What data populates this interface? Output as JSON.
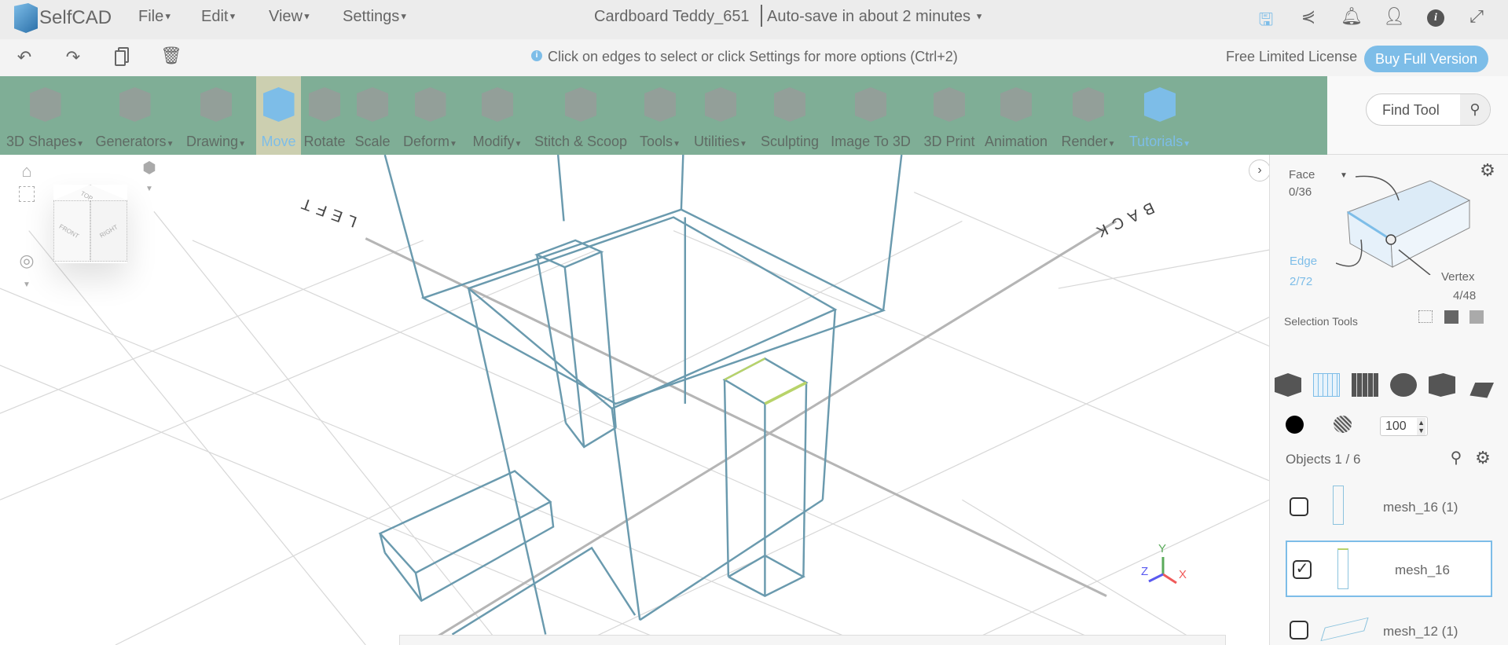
{
  "app": {
    "name": "SelfCAD",
    "document_title": "Cardboard Teddy_651",
    "autosave": "Auto-save in about 2 minutes"
  },
  "menu": [
    {
      "label": "File"
    },
    {
      "label": "Edit"
    },
    {
      "label": "View"
    },
    {
      "label": "Settings"
    }
  ],
  "header_icons": [
    "save-icon",
    "share-icon",
    "bell-icon",
    "user-icon",
    "info-icon",
    "fullscreen-icon"
  ],
  "toolbar": {
    "hint": "Click on edges to select or click Settings for more options (Ctrl+2)",
    "license": "Free Limited License",
    "buy_label": "Buy Full Version"
  },
  "ribbon": [
    {
      "label": "3D Shapes",
      "dropdown": true
    },
    {
      "label": "Generators",
      "dropdown": true
    },
    {
      "label": "Drawing",
      "dropdown": true
    },
    {
      "label": "Move",
      "active": true
    },
    {
      "label": "Rotate"
    },
    {
      "label": "Scale"
    },
    {
      "label": "Deform",
      "dropdown": true
    },
    {
      "label": "Modify",
      "dropdown": true
    },
    {
      "label": "Stitch & Scoop"
    },
    {
      "label": "Tools",
      "dropdown": true
    },
    {
      "label": "Utilities",
      "dropdown": true
    },
    {
      "label": "Sculpting"
    },
    {
      "label": "Image To 3D"
    },
    {
      "label": "3D Print"
    },
    {
      "label": "Animation"
    },
    {
      "label": "Render",
      "dropdown": true
    },
    {
      "label": "Tutorials",
      "dropdown": true
    }
  ],
  "find_tool": {
    "placeholder": "Find Tool"
  },
  "viewport": {
    "cube_faces": {
      "top": "TOP",
      "front": "FRONT",
      "right": "RIGHT"
    },
    "labels": {
      "left": "LEFT",
      "back": "BACK"
    },
    "axes": {
      "x": "X",
      "y": "Y",
      "z": "Z"
    },
    "colors": {
      "x": "#f05a5a",
      "y": "#5aaa5a",
      "z": "#5a5af0"
    }
  },
  "panel": {
    "face_label": "Face",
    "face_count": "0/36",
    "edge_label": "Edge",
    "edge_count": "2/72",
    "vertex_label": "Vertex",
    "vertex_count": "4/48",
    "selection_tools": "Selection Tools",
    "brush_size": "100",
    "objects_title": "Objects 1 / 6",
    "objects": [
      {
        "name": "mesh_16 (1)",
        "checked": false
      },
      {
        "name": "mesh_16",
        "checked": true
      },
      {
        "name": "mesh_12 (1)",
        "checked": false
      }
    ]
  },
  "colors": {
    "ribbon": "#7fae96",
    "accent": "#7dbde8",
    "active_tool": "#cccfb0"
  }
}
